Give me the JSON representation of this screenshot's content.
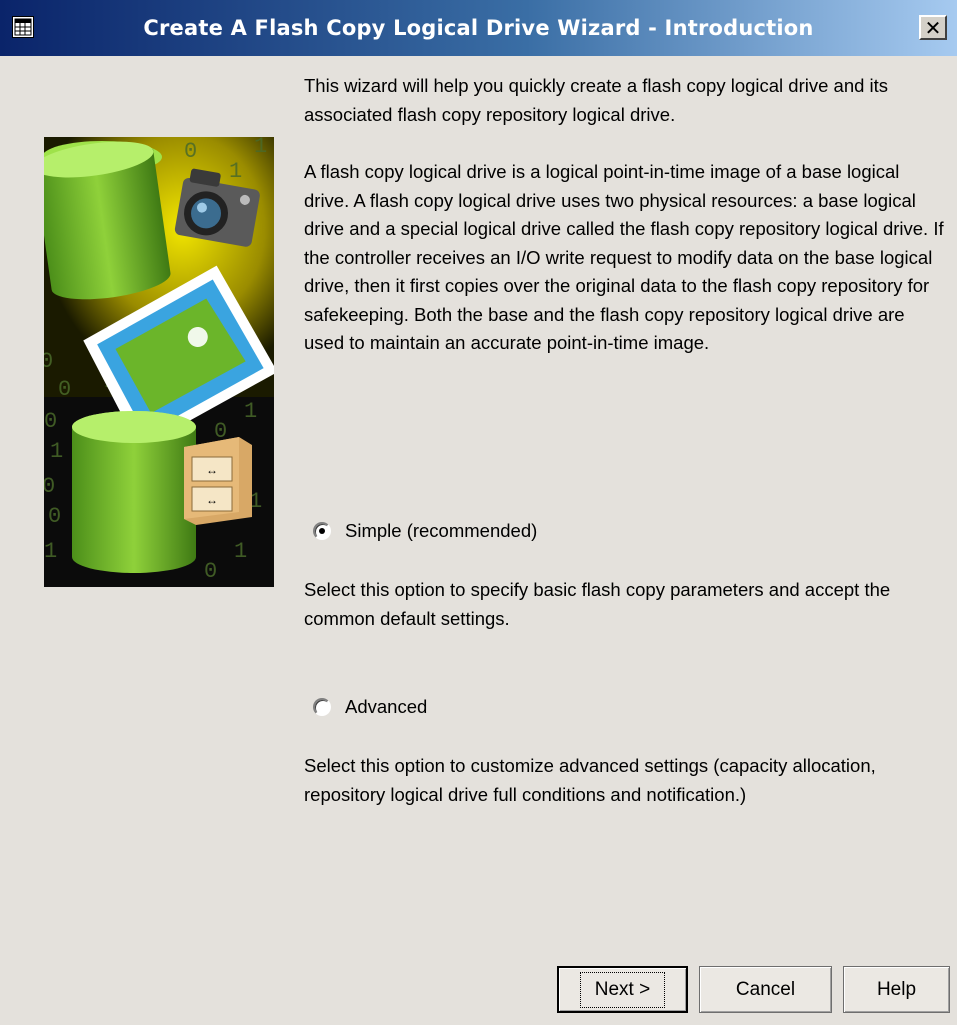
{
  "window": {
    "title": "Create A Flash Copy Logical Drive Wizard - Introduction",
    "close_label": "✕"
  },
  "illustration": {
    "digits": [
      "0",
      "1",
      "0",
      "0",
      "1",
      "1",
      "0",
      "1",
      "0",
      "1",
      "0",
      "0",
      "1",
      "0",
      "1",
      "1",
      "0",
      "1"
    ]
  },
  "intro": {
    "paragraph1": "This wizard will help you quickly create a flash copy logical drive and its associated flash copy repository logical drive.",
    "paragraph2": "A flash copy logical drive is a logical point-in-time image of a base logical drive. A flash copy logical drive uses two physical resources: a base logical drive and a special logical drive called the flash copy repository logical drive. If the controller receives an I/O write request to modify data on the base logical drive, then it first copies over the original data to the flash copy repository for safekeeping. Both the base and the flash copy repository logical drive are used to maintain an accurate point-in-time image."
  },
  "options": {
    "simple": {
      "label": "Simple (recommended)",
      "description": "Select this option to specify basic flash copy parameters and accept the common default settings.",
      "selected": true
    },
    "advanced": {
      "label": "Advanced",
      "description": "Select this option to customize advanced settings (capacity allocation, repository logical drive full conditions and notification.)",
      "selected": false
    }
  },
  "buttons": {
    "next": "Next >",
    "cancel": "Cancel",
    "help": "Help"
  }
}
